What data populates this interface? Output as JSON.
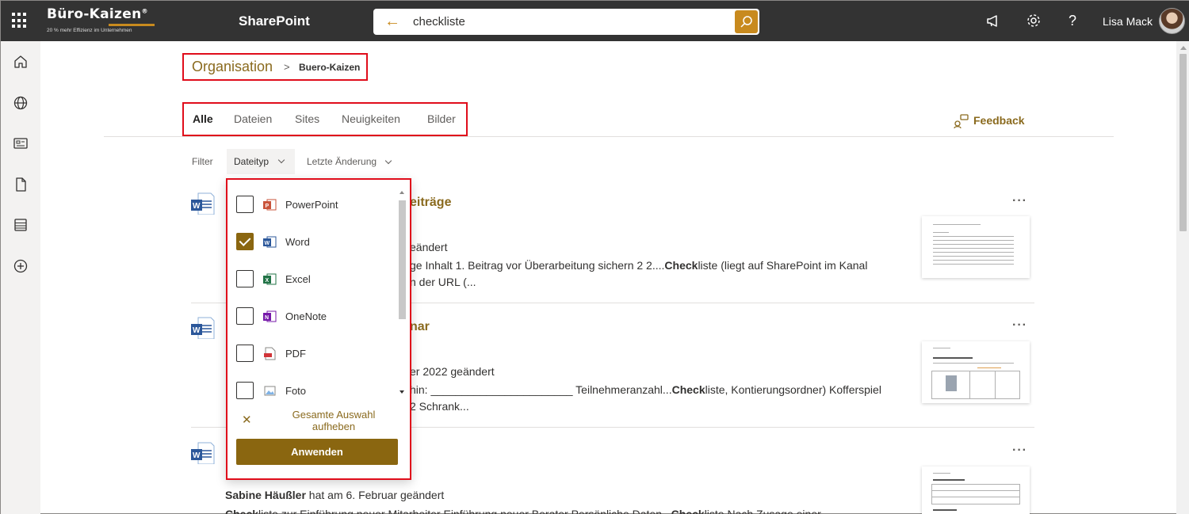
{
  "header": {
    "logo_name": "Büro-Kaizen",
    "logo_reg": "®",
    "logo_tagline": "20 % mehr Effizienz im Unternehmen",
    "app_name": "SharePoint",
    "search_value": "checkliste",
    "user_name": "Lisa Mack"
  },
  "breadcrumb": {
    "root": "Organisation",
    "separator": ">",
    "current": "Buero-Kaizen"
  },
  "tabs": [
    {
      "label": "Alle",
      "active": true
    },
    {
      "label": "Dateien",
      "active": false
    },
    {
      "label": "Sites",
      "active": false
    },
    {
      "label": "Neuigkeiten",
      "active": false
    },
    {
      "label": "Bilder",
      "active": false
    }
  ],
  "feedback_label": "Feedback",
  "filter": {
    "label": "Filter",
    "file_type": "Dateityp",
    "last_change": "Letzte Änderung"
  },
  "dropdown": {
    "options": [
      {
        "label": "PowerPoint",
        "checked": false,
        "icon": "powerpoint-icon"
      },
      {
        "label": "Word",
        "checked": true,
        "icon": "word-icon"
      },
      {
        "label": "Excel",
        "checked": false,
        "icon": "excel-icon"
      },
      {
        "label": "OneNote",
        "checked": false,
        "icon": "onenote-icon"
      },
      {
        "label": "PDF",
        "checked": false,
        "icon": "pdf-icon"
      },
      {
        "label": "Foto",
        "checked": false,
        "icon": "photo-icon"
      }
    ],
    "clear_line1": "Gesamte Auswahl",
    "clear_line2": "aufheben",
    "apply": "Anwenden"
  },
  "results": [
    {
      "title_visible": "eiträge",
      "meta_visible": "eändert",
      "snippet_line1_a": "ge Inhalt 1. Beitrag vor Überarbeitung sichern 2 2....",
      "snippet_line1_b": "Check",
      "snippet_line1_c": "liste (liegt auf SharePoint im Kanal",
      "snippet_line2": "n der URL (..."
    },
    {
      "title_visible": "nar",
      "meta_visible": "er 2022 geändert",
      "snippet_line1_a": "hin: _______________________ Teilnehmeranzahl...",
      "snippet_line1_b": "Check",
      "snippet_line1_c": "liste, Kontierungsordner) Kofferspiel",
      "snippet_line2": "2 Schrank..."
    },
    {
      "author": "Sabine Häußler",
      "meta_rest": " hat am 6. Februar geändert",
      "snippet_a": "Check",
      "snippet_b": "liste zur Einführung neuer Mitarbeiter Einführung neuer Berater Persönliche Daten...",
      "snippet_c": "Check",
      "snippet_d": "liste Nach Zusage einer"
    }
  ],
  "more_label": "···",
  "colors": {
    "topbar": "#333333",
    "accent": "#c88a1e",
    "brand_dark": "#8a6610",
    "link": "#8a6a1e",
    "highlight_border": "#e00d1b"
  }
}
